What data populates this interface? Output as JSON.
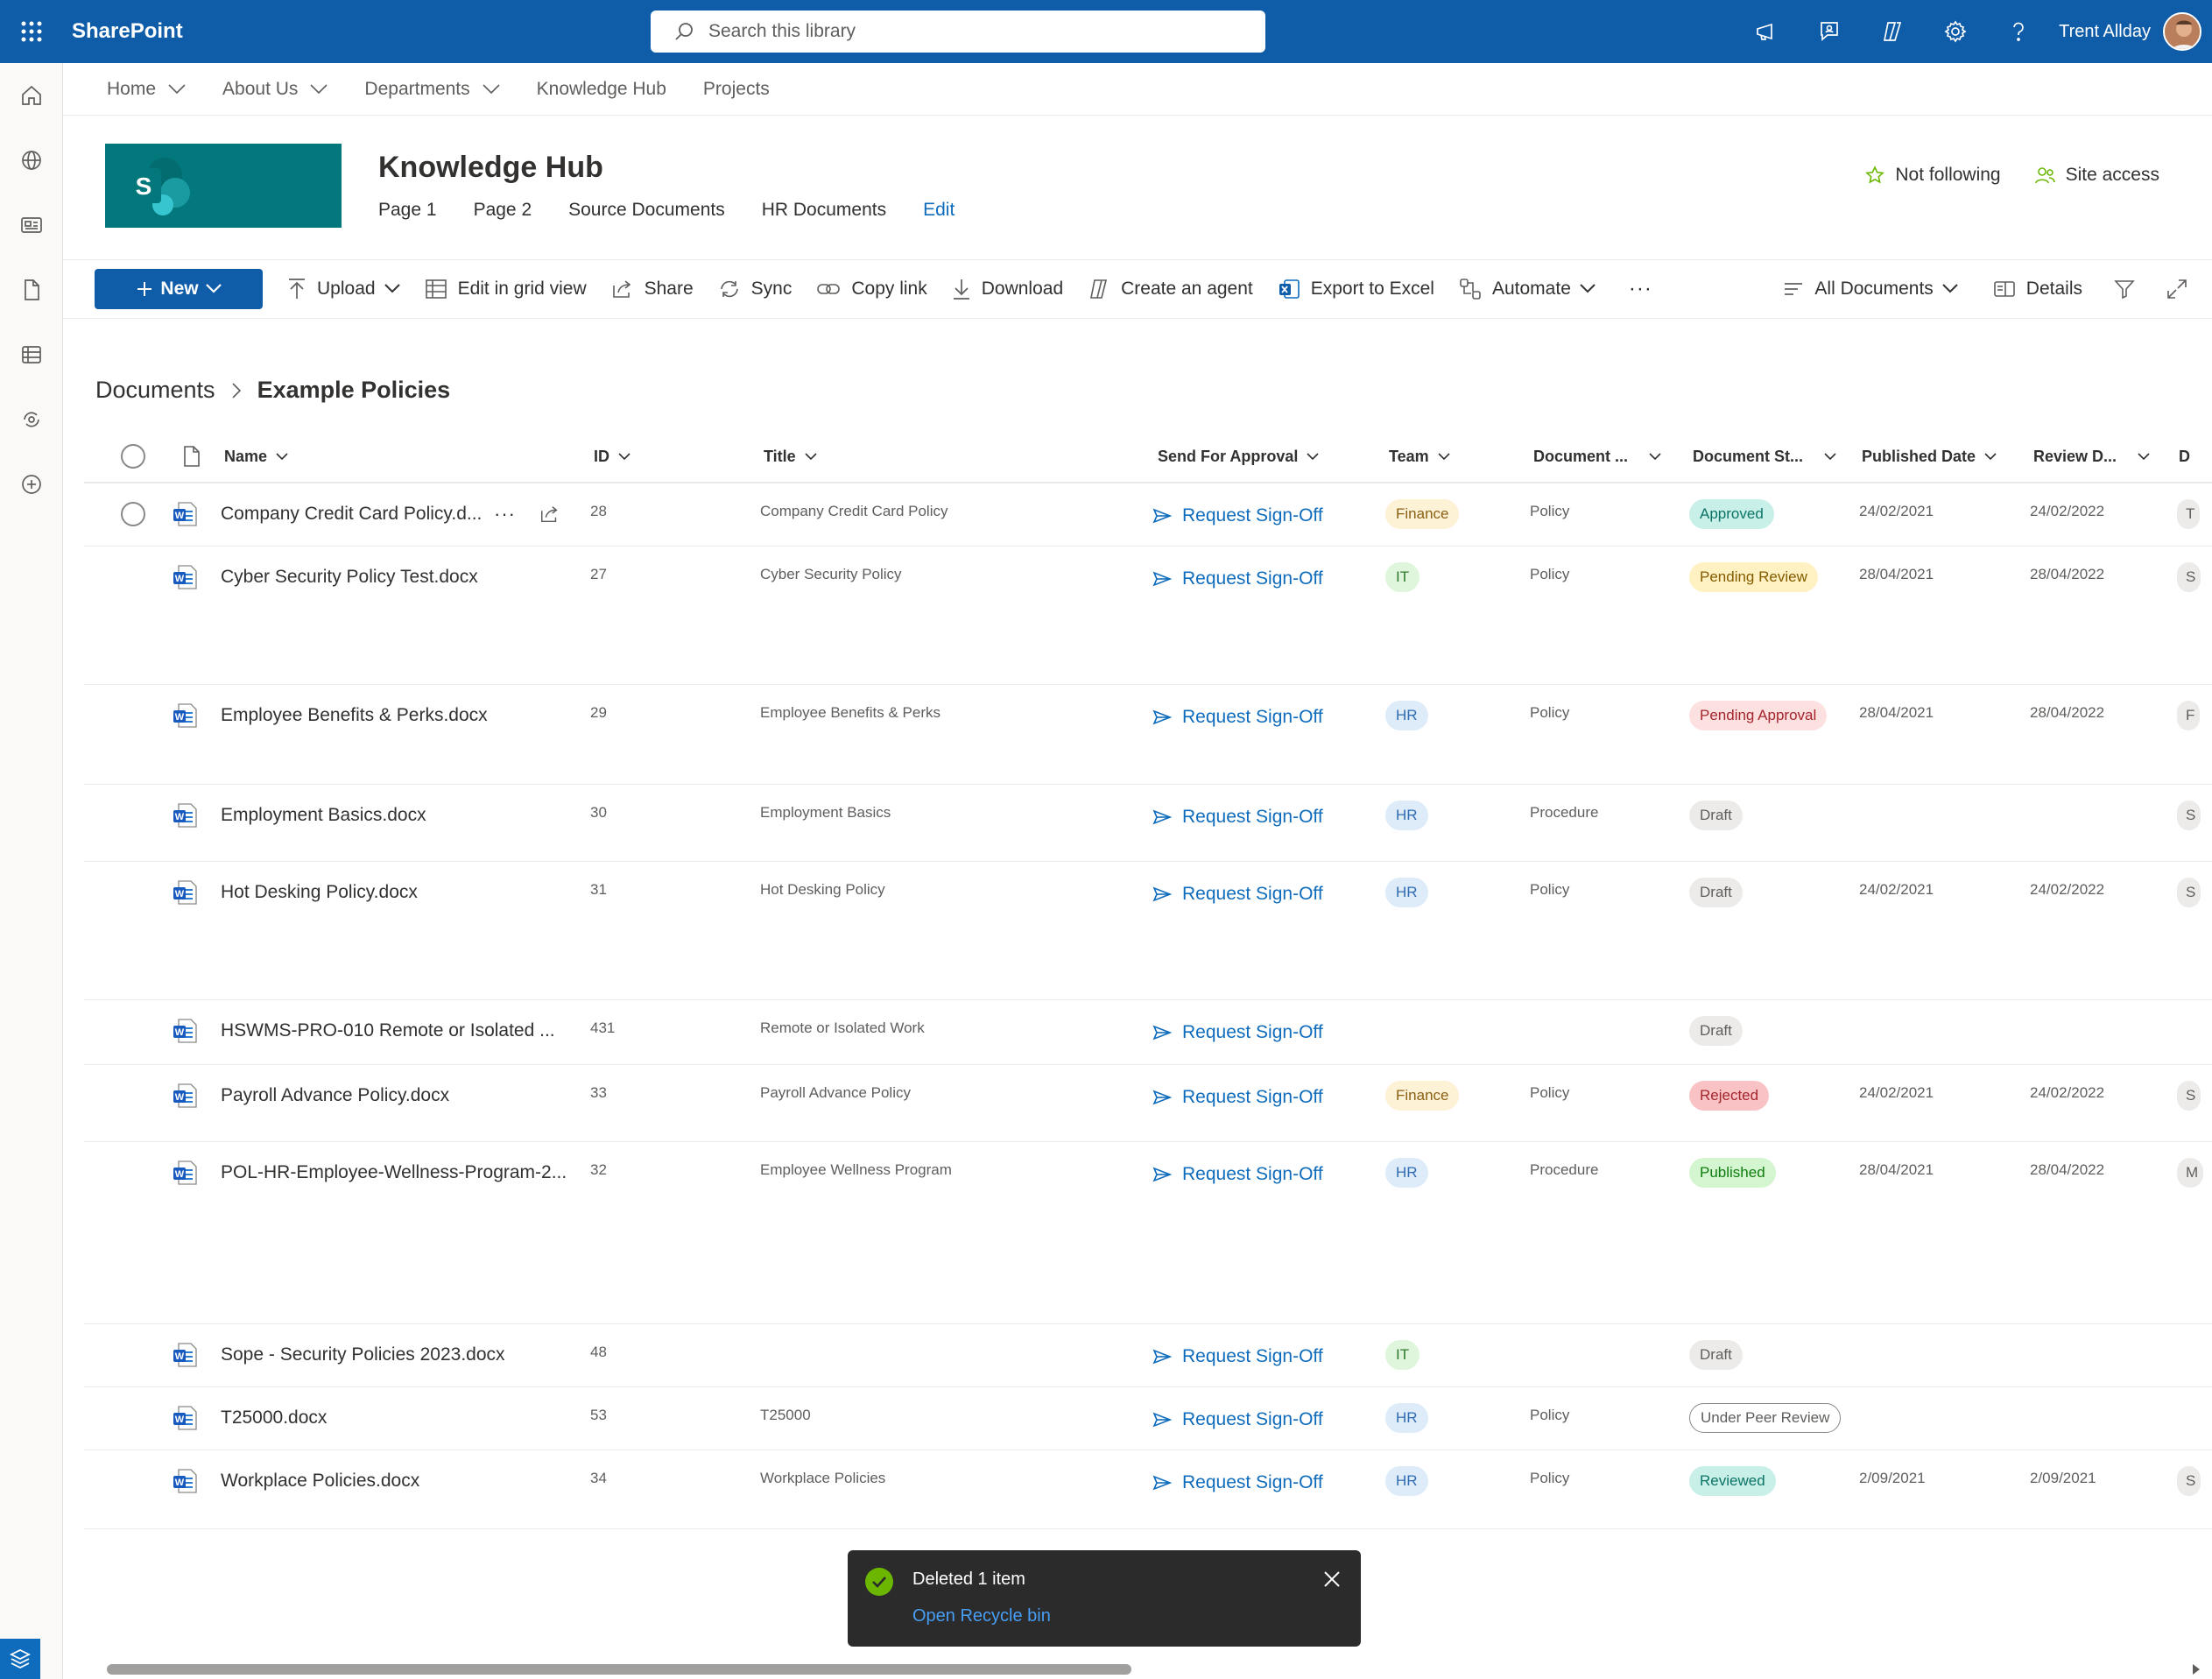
{
  "topbar": {
    "brand": "SharePoint",
    "search_placeholder": "Search this library",
    "user_name": "Trent Allday"
  },
  "hub_nav": [
    "Home",
    "About Us",
    "Departments",
    "Knowledge Hub",
    "Projects"
  ],
  "site": {
    "logo_letter": "S",
    "title": "Knowledge Hub",
    "nav": [
      "Page 1",
      "Page 2",
      "Source Documents",
      "HR Documents"
    ],
    "edit_label": "Edit",
    "not_following": "Not following",
    "site_access": "Site access"
  },
  "commands": {
    "new": "New",
    "upload": "Upload",
    "grid": "Edit in grid view",
    "share": "Share",
    "sync": "Sync",
    "copy_link": "Copy link",
    "download": "Download",
    "agent": "Create an agent",
    "excel": "Export to Excel",
    "automate": "Automate",
    "more": "···",
    "view": "All Documents",
    "details": "Details"
  },
  "breadcrumb": {
    "root": "Documents",
    "current": "Example Policies"
  },
  "columns": {
    "name": "Name",
    "id": "ID",
    "title": "Title",
    "approval": "Send For Approval",
    "team": "Team",
    "doc_type": "Document ...",
    "doc_status": "Document St...",
    "published": "Published Date",
    "review": "Review D...",
    "extra": "D"
  },
  "rows": [
    {
      "name": "Company Credit Card Policy.d...",
      "id": "28",
      "title": "Company Credit Card Policy",
      "action": "Request Sign-Off",
      "team": "Finance",
      "type": "Policy",
      "status": "Approved",
      "published": "24/02/2021",
      "review": "24/02/2022",
      "extra": "T"
    },
    {
      "name": "Cyber Security Policy Test.docx",
      "id": "27",
      "title": "Cyber Security Policy",
      "action": "Request Sign-Off",
      "team": "IT",
      "type": "Policy",
      "status": "Pending Review",
      "published": "28/04/2021",
      "review": "28/04/2022",
      "extra": "S"
    },
    {
      "name": "Employee Benefits & Perks.docx",
      "id": "29",
      "title": "Employee Benefits & Perks",
      "action": "Request Sign-Off",
      "team": "HR",
      "type": "Policy",
      "status": "Pending Approval",
      "published": "28/04/2021",
      "review": "28/04/2022",
      "extra": "F"
    },
    {
      "name": "Employment Basics.docx",
      "id": "30",
      "title": "Employment Basics",
      "action": "Request Sign-Off",
      "team": "HR",
      "type": "Procedure",
      "status": "Draft",
      "published": "",
      "review": "",
      "extra": "S"
    },
    {
      "name": "Hot Desking Policy.docx",
      "id": "31",
      "title": "Hot Desking Policy",
      "action": "Request Sign-Off",
      "team": "HR",
      "type": "Policy",
      "status": "Draft",
      "published": "24/02/2021",
      "review": "24/02/2022",
      "extra": "S"
    },
    {
      "name": "HSWMS-PRO-010 Remote or Isolated ...",
      "id": "431",
      "title": "Remote or Isolated Work",
      "action": "Request Sign-Off",
      "team": "",
      "type": "",
      "status": "Draft",
      "published": "",
      "review": "",
      "extra": ""
    },
    {
      "name": "Payroll Advance Policy.docx",
      "id": "33",
      "title": "Payroll Advance Policy",
      "action": "Request Sign-Off",
      "team": "Finance",
      "type": "Policy",
      "status": "Rejected",
      "published": "24/02/2021",
      "review": "24/02/2022",
      "extra": "S"
    },
    {
      "name": "POL-HR-Employee-Wellness-Program-2...",
      "id": "32",
      "title": "Employee Wellness Program",
      "action": "Request Sign-Off",
      "team": "HR",
      "type": "Procedure",
      "status": "Published",
      "published": "28/04/2021",
      "review": "28/04/2022",
      "extra": "M"
    },
    {
      "name": "Sope - Security Policies 2023.docx",
      "id": "48",
      "title": "",
      "action": "Request Sign-Off",
      "team": "IT",
      "type": "",
      "status": "Draft",
      "published": "",
      "review": "",
      "extra": ""
    },
    {
      "name": "T25000.docx",
      "id": "53",
      "title": "T25000",
      "action": "Request Sign-Off",
      "team": "HR",
      "type": "Policy",
      "status": "Under Peer Review",
      "published": "",
      "review": "",
      "extra": ""
    },
    {
      "name": "Workplace Policies.docx",
      "id": "34",
      "title": "Workplace Policies",
      "action": "Request Sign-Off",
      "team": "HR",
      "type": "Policy",
      "status": "Reviewed",
      "published": "2/09/2021",
      "review": "2/09/2021",
      "extra": "S"
    }
  ],
  "toast": {
    "message": "Deleted 1 item",
    "link": "Open Recycle bin"
  },
  "colors": {
    "suite_bar": "#0f5ca8",
    "link": "#0f6cbd",
    "team": {
      "Finance": [
        "#fdf1d6",
        "#8a6116"
      ],
      "IT": [
        "#dff6dd",
        "#2e7a2e"
      ],
      "HR": [
        "#deecf9",
        "#2f6cb3"
      ]
    },
    "status": {
      "Approved": [
        "#c9efe9",
        "#0b7466",
        "none"
      ],
      "Pending Review": [
        "#fff1c2",
        "#835c00",
        "none"
      ],
      "Pending Approval": [
        "#fde0e0",
        "#a4262c",
        "none"
      ],
      "Draft": [
        "#edebe9",
        "#605e5c",
        "none"
      ],
      "Rejected": [
        "#f9c3c6",
        "#a4262c",
        "none"
      ],
      "Published": [
        "#d3f5d0",
        "#107c10",
        "none"
      ],
      "Under Peer Review": [
        "#ffffff",
        "#605e5c",
        "1px solid #8a8886"
      ],
      "Reviewed": [
        "#c9efe9",
        "#0b7466",
        "none"
      ]
    }
  }
}
